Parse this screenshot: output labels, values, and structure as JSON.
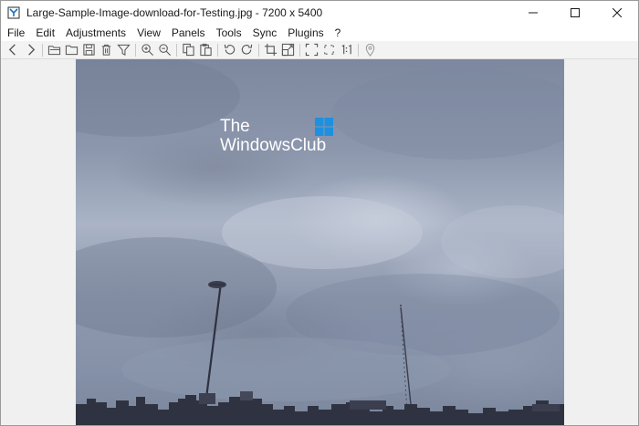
{
  "window": {
    "title": "Large-Sample-Image-download-for-Testing.jpg  - 7200 x 5400"
  },
  "menu": [
    "File",
    "Edit",
    "Adjustments",
    "View",
    "Panels",
    "Tools",
    "Sync",
    "Plugins",
    "?"
  ],
  "toolbar": {
    "icons": [
      "back-icon",
      "forward-icon",
      "open-folder-icon",
      "folder-icon",
      "save-icon",
      "delete-icon",
      "filter-icon",
      "zoom-in-icon",
      "zoom-out-icon",
      "copy-icon",
      "paste-icon",
      "rotate-left-icon",
      "rotate-right-icon",
      "crop-icon",
      "resize-icon",
      "fullscreen-icon",
      "fit-icon",
      "actual-size-icon",
      "location-icon"
    ]
  },
  "watermark": {
    "line1": "The",
    "line2": "WindowsClub"
  },
  "colors": {
    "logo_blue": "#1e90e0"
  }
}
